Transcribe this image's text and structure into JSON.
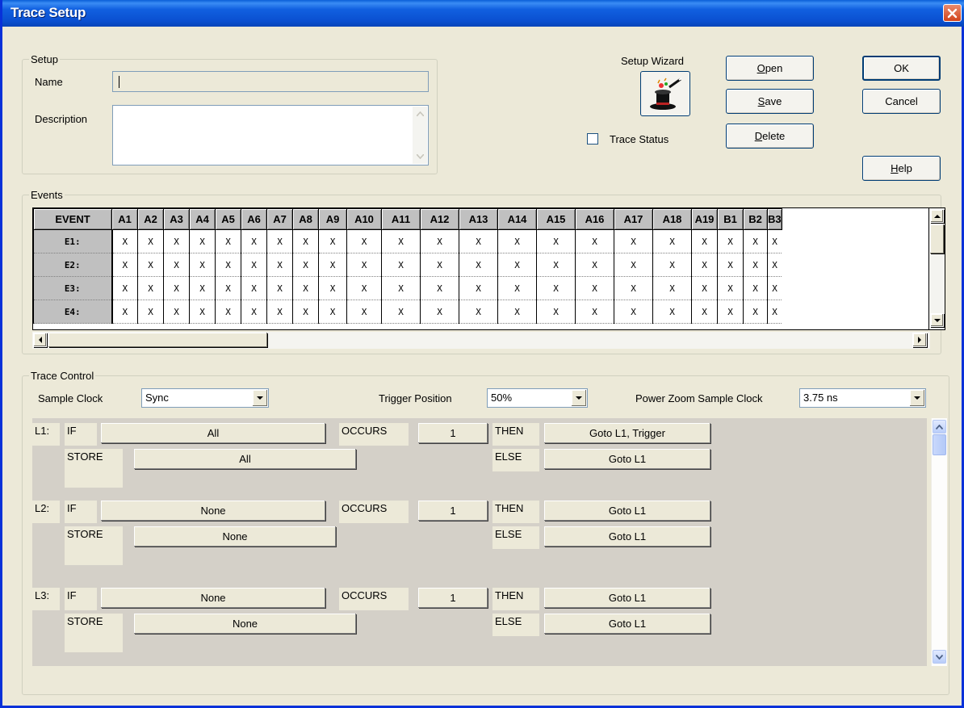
{
  "window": {
    "title": "Trace Setup"
  },
  "setup": {
    "group_label": "Setup",
    "name_label": "Name",
    "name_value": "",
    "description_label": "Description",
    "description_value": ""
  },
  "wizard": {
    "label": "Setup Wizard"
  },
  "trace_status": {
    "label": "Trace Status",
    "checked": false
  },
  "buttons": {
    "open": {
      "mnemonic": "O",
      "rest": "pen"
    },
    "save": {
      "mnemonic": "S",
      "rest": "ave"
    },
    "delete": {
      "mnemonic": "D",
      "rest": "elete"
    },
    "ok": "OK",
    "cancel": "Cancel",
    "help": {
      "mnemonic": "H",
      "rest": "elp"
    }
  },
  "events": {
    "group_label": "Events",
    "header": "EVENT",
    "columns": [
      "A1",
      "A2",
      "A3",
      "A4",
      "A5",
      "A6",
      "A7",
      "A8",
      "A9",
      "A10",
      "A11",
      "A12",
      "A13",
      "A14",
      "A15",
      "A16",
      "A17",
      "A18",
      "A19",
      "B1",
      "B2",
      "B3"
    ],
    "rows": [
      {
        "label": "E1:",
        "cell": "X"
      },
      {
        "label": "E2:",
        "cell": "X"
      },
      {
        "label": "E3:",
        "cell": "X"
      },
      {
        "label": "E4:",
        "cell": "X"
      }
    ]
  },
  "trace_control": {
    "group_label": "Trace Control",
    "sample_clock_label": "Sample Clock",
    "sample_clock_value": "Sync",
    "trigger_position_label": "Trigger Position",
    "trigger_position_value": "50%",
    "power_zoom_label": "Power Zoom Sample Clock",
    "power_zoom_value": "3.75 ns"
  },
  "levels": [
    {
      "label": "L1:",
      "if_kw": "IF",
      "if_value": "All",
      "occurs_kw": "OCCURS",
      "occurs_value": "1",
      "then_kw": "THEN",
      "then_value": "Goto L1, Trigger",
      "store_kw": "STORE",
      "store_value": "All",
      "else_kw": "ELSE",
      "else_value": "Goto L1"
    },
    {
      "label": "L2:",
      "if_kw": "IF",
      "if_value": "None",
      "occurs_kw": "OCCURS",
      "occurs_value": "1",
      "then_kw": "THEN",
      "then_value": "Goto L1",
      "store_kw": "STORE",
      "store_value": "None",
      "else_kw": "ELSE",
      "else_value": "Goto L1"
    },
    {
      "label": "L3:",
      "if_kw": "IF",
      "if_value": "None",
      "occurs_kw": "OCCURS",
      "occurs_value": "1",
      "then_kw": "THEN",
      "then_value": "Goto L1",
      "store_kw": "STORE",
      "store_value": "None",
      "else_kw": "ELSE",
      "else_value": "Goto L1"
    }
  ]
}
